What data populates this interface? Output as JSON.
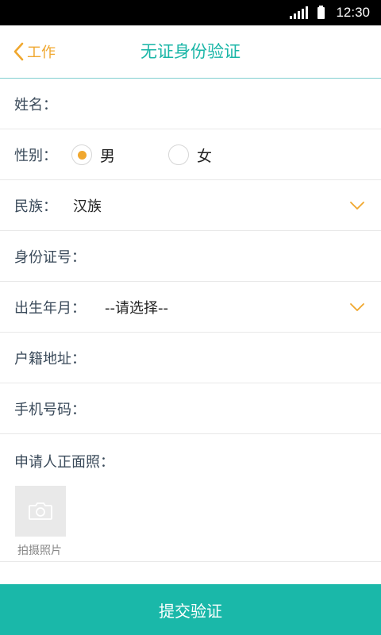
{
  "status_bar": {
    "time": "12:30"
  },
  "header": {
    "back_label": "工作",
    "title": "无证身份验证"
  },
  "form": {
    "name": {
      "label": "姓名：",
      "value": ""
    },
    "gender": {
      "label": "性别：",
      "options": [
        "男",
        "女"
      ],
      "selected": "男"
    },
    "ethnicity": {
      "label": "民族：",
      "value": "汉族"
    },
    "id_number": {
      "label": "身份证号：",
      "value": ""
    },
    "birth_date": {
      "label": "出生年月：",
      "value": "--请选择--"
    },
    "address": {
      "label": "户籍地址：",
      "value": ""
    },
    "phone": {
      "label": "手机号码：",
      "value": ""
    },
    "photo": {
      "label": "申请人正面照：",
      "caption": "拍摄照片"
    }
  },
  "submit_label": "提交验证",
  "colors": {
    "accent": "#1ab8a9",
    "orange": "#f0a72e",
    "title": "#1ab6a7"
  }
}
